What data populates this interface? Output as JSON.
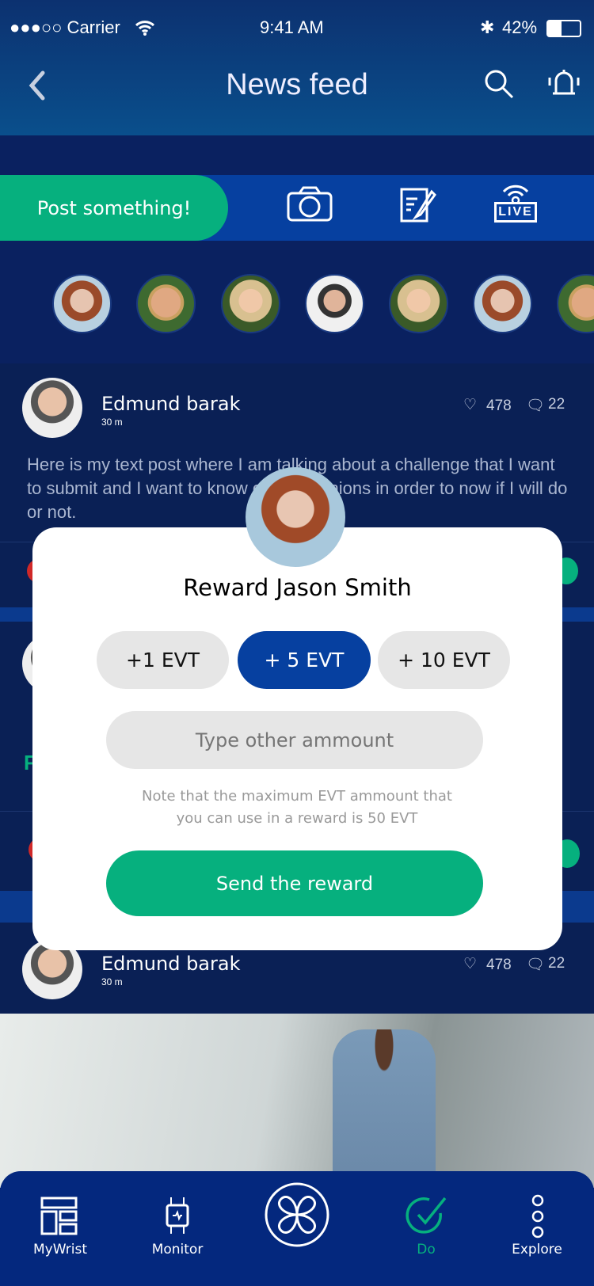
{
  "status": {
    "carrier": "●●●○○ Carrier",
    "time": "9:41 AM",
    "battery": "42%",
    "battery_level": 0.42
  },
  "header": {
    "title": "News feed"
  },
  "compose": {
    "post_label": "Post something!",
    "icons": [
      "camera-icon",
      "note-edit-icon",
      "live-icon"
    ],
    "live_label": "LIVE"
  },
  "stories": [
    "avatar-woman-red-hair",
    "avatar-man-smiling",
    "avatar-woman-blonde",
    "avatar-man-bald",
    "avatar-woman-blonde",
    "avatar-woman-red-hair",
    "avatar-man-smiling"
  ],
  "posts": [
    {
      "author": "Edmund barak",
      "time": "30 m",
      "likes": "478",
      "comments": "22",
      "text": "Here is my text post where I am talking about a challenge that I want to submit and I want to know others opinions in order to now if I will do or not."
    },
    {
      "author": "Edmund barak",
      "time": "30 m",
      "likes": "478",
      "comments": "22"
    }
  ],
  "modal": {
    "title": "Reward Jason Smith",
    "options": [
      "+1 EVT",
      "+ 5 EVT",
      "+ 10 EVT"
    ],
    "selected": "+ 5 EVT",
    "input_placeholder": "Type other ammount",
    "note": "Note that the maximum EVT ammount that you can use in a reward is 50 EVT",
    "send_label": "Send the reward"
  },
  "nav": {
    "items": [
      {
        "label": "MyWrist"
      },
      {
        "label": "Monitor"
      },
      {
        "label": ""
      },
      {
        "label": "Do",
        "active": true
      },
      {
        "label": "Explore"
      }
    ]
  },
  "colors": {
    "green": "#06b07e",
    "blue": "#0640a0",
    "navy": "#0a2160"
  }
}
